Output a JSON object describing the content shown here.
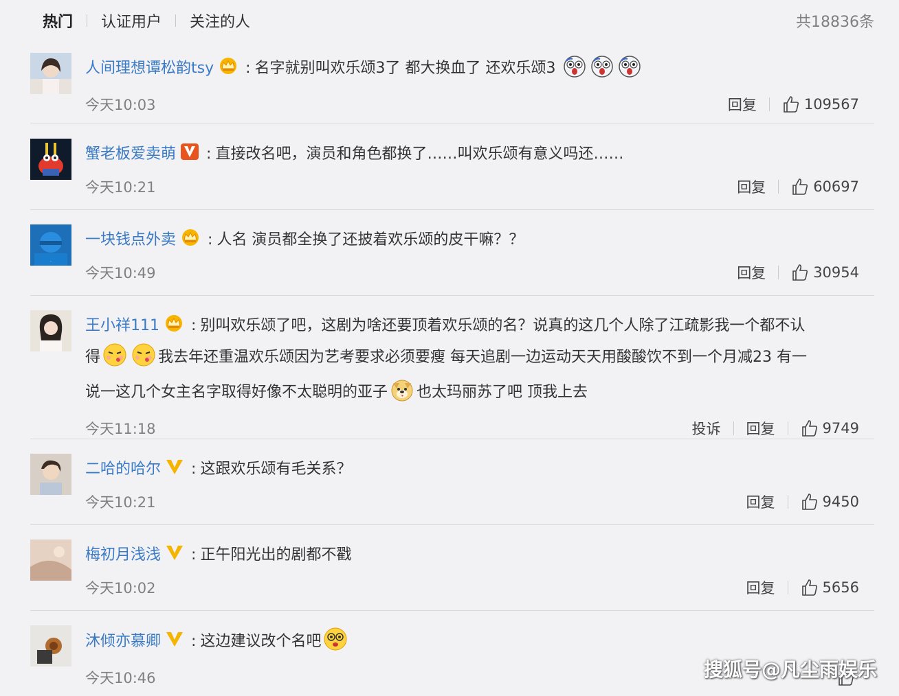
{
  "tabs": {
    "hot": "热门",
    "verified": "认证用户",
    "following": "关注的人"
  },
  "total": "共18836条",
  "actions": {
    "reply": "回复",
    "report": "投诉"
  },
  "comments": [
    {
      "user": "人间理想谭松韵tsy",
      "badge": "crown-icon",
      "text": "名字就别叫欢乐颂3了 都大换血了 还欢乐颂3",
      "emoji_after": "scared-face-emoji ×3",
      "time": "今天10:03",
      "likes": "109567"
    },
    {
      "user": "蟹老板爱卖萌",
      "badge": "vip-v-icon",
      "text": "直接改名吧，演员和角色都换了……叫欢乐颂有意义吗还……",
      "time": "今天10:21",
      "likes": "60697"
    },
    {
      "user": "一块钱点外卖",
      "badge": "crown-icon",
      "text": "人名 演员都全换了还披着欢乐颂的皮干嘛？？",
      "time": "今天10:49",
      "likes": "30954"
    },
    {
      "user": "王小祥111",
      "badge": "crown-icon",
      "text_1": "别叫欢乐颂了吧，这剧为啥还要顶着欢乐颂的名？说真的这几个人除了江疏影我一个都不认",
      "text_2": "得",
      "text_3": "我去年还重温欢乐颂因为艺考要求必须要瘦 每天追剧一边运动天天用酸酸饮不到一个月减23 有一",
      "text_4": "说一这几个女主名字取得好像不太聪明的亚子",
      "text_5": "也太玛丽苏了吧 顶我上去",
      "time": "今天11:18",
      "likes": "9749"
    },
    {
      "user": "二哈的哈尔",
      "badge": "yellow-v-icon",
      "text": "这跟欢乐颂有毛关系？",
      "time": "今天10:21",
      "likes": "9450"
    },
    {
      "user": "梅初月浅浅",
      "badge": "yellow-v-icon",
      "text": "正午阳光出的剧都不戳",
      "time": "今天10:02",
      "likes": "5656"
    },
    {
      "user": "沐倾亦慕卿",
      "badge": "yellow-v-icon",
      "text": "这边建议改个名吧",
      "time": "今天10:46",
      "likes": ""
    }
  ],
  "watermark": "搜狐号@凡尘雨娱乐",
  "colors": {
    "username": "#3b7bc6",
    "time": "#808080",
    "background": "#f2f2f5"
  }
}
